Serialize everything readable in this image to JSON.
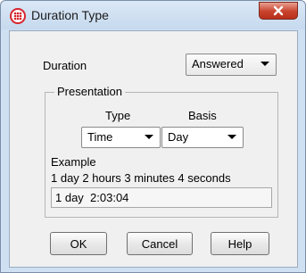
{
  "window": {
    "title": "Duration Type",
    "app_icon": "telephony-app-icon",
    "close_icon": "close-icon"
  },
  "form": {
    "duration_label": "Duration",
    "duration_value": "Answered",
    "presentation_legend": "Presentation",
    "type_label": "Type",
    "basis_label": "Basis",
    "type_value": "Time",
    "basis_value": "Day",
    "example_label": "Example",
    "example_description": "1 day 2 hours 3 minutes 4 seconds",
    "example_value": "1 day  2:03:04"
  },
  "buttons": {
    "ok": "OK",
    "cancel": "Cancel",
    "help": "Help"
  },
  "colors": {
    "titlebar": "#c6d9ee",
    "close_button": "#c8412c",
    "app_icon_red": "#d6262e",
    "dialog_bg": "#f0f0f0"
  }
}
